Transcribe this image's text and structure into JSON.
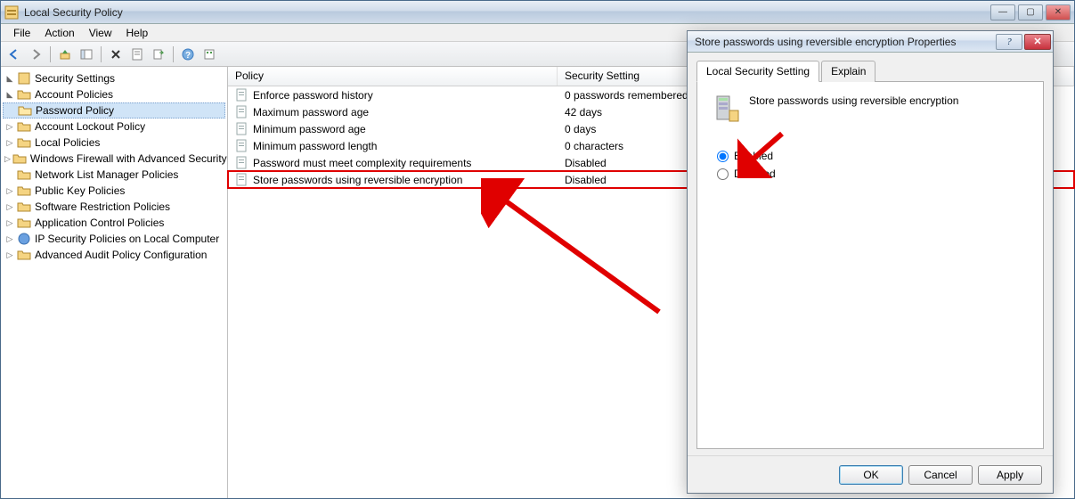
{
  "window": {
    "title": "Local Security Policy"
  },
  "menubar": [
    "File",
    "Action",
    "View",
    "Help"
  ],
  "tree": {
    "root": "Security Settings",
    "nodes": [
      {
        "label": "Account Policies",
        "children": [
          {
            "label": "Password Policy",
            "selected": true
          },
          {
            "label": "Account Lockout Policy"
          }
        ]
      },
      {
        "label": "Local Policies"
      },
      {
        "label": "Windows Firewall with Advanced Security"
      },
      {
        "label": "Network List Manager Policies"
      },
      {
        "label": "Public Key Policies"
      },
      {
        "label": "Software Restriction Policies"
      },
      {
        "label": "Application Control Policies"
      },
      {
        "label": "IP Security Policies on Local Computer"
      },
      {
        "label": "Advanced Audit Policy Configuration"
      }
    ]
  },
  "list": {
    "columns": {
      "policy": "Policy",
      "setting": "Security Setting"
    },
    "rows": [
      {
        "policy": "Enforce password history",
        "setting": "0 passwords remembered"
      },
      {
        "policy": "Maximum password age",
        "setting": "42 days"
      },
      {
        "policy": "Minimum password age",
        "setting": "0 days"
      },
      {
        "policy": "Minimum password length",
        "setting": "0 characters"
      },
      {
        "policy": "Password must meet complexity requirements",
        "setting": "Disabled"
      },
      {
        "policy": "Store passwords using reversible encryption",
        "setting": "Disabled",
        "highlighted": true
      }
    ]
  },
  "dialog": {
    "title": "Store passwords using reversible encryption Properties",
    "tabs": {
      "local": "Local Security Setting",
      "explain": "Explain"
    },
    "heading": "Store passwords using reversible encryption",
    "options": {
      "enabled": "Enabled",
      "disabled": "Disabled"
    },
    "selected": "enabled",
    "buttons": {
      "ok": "OK",
      "cancel": "Cancel",
      "apply": "Apply"
    }
  }
}
